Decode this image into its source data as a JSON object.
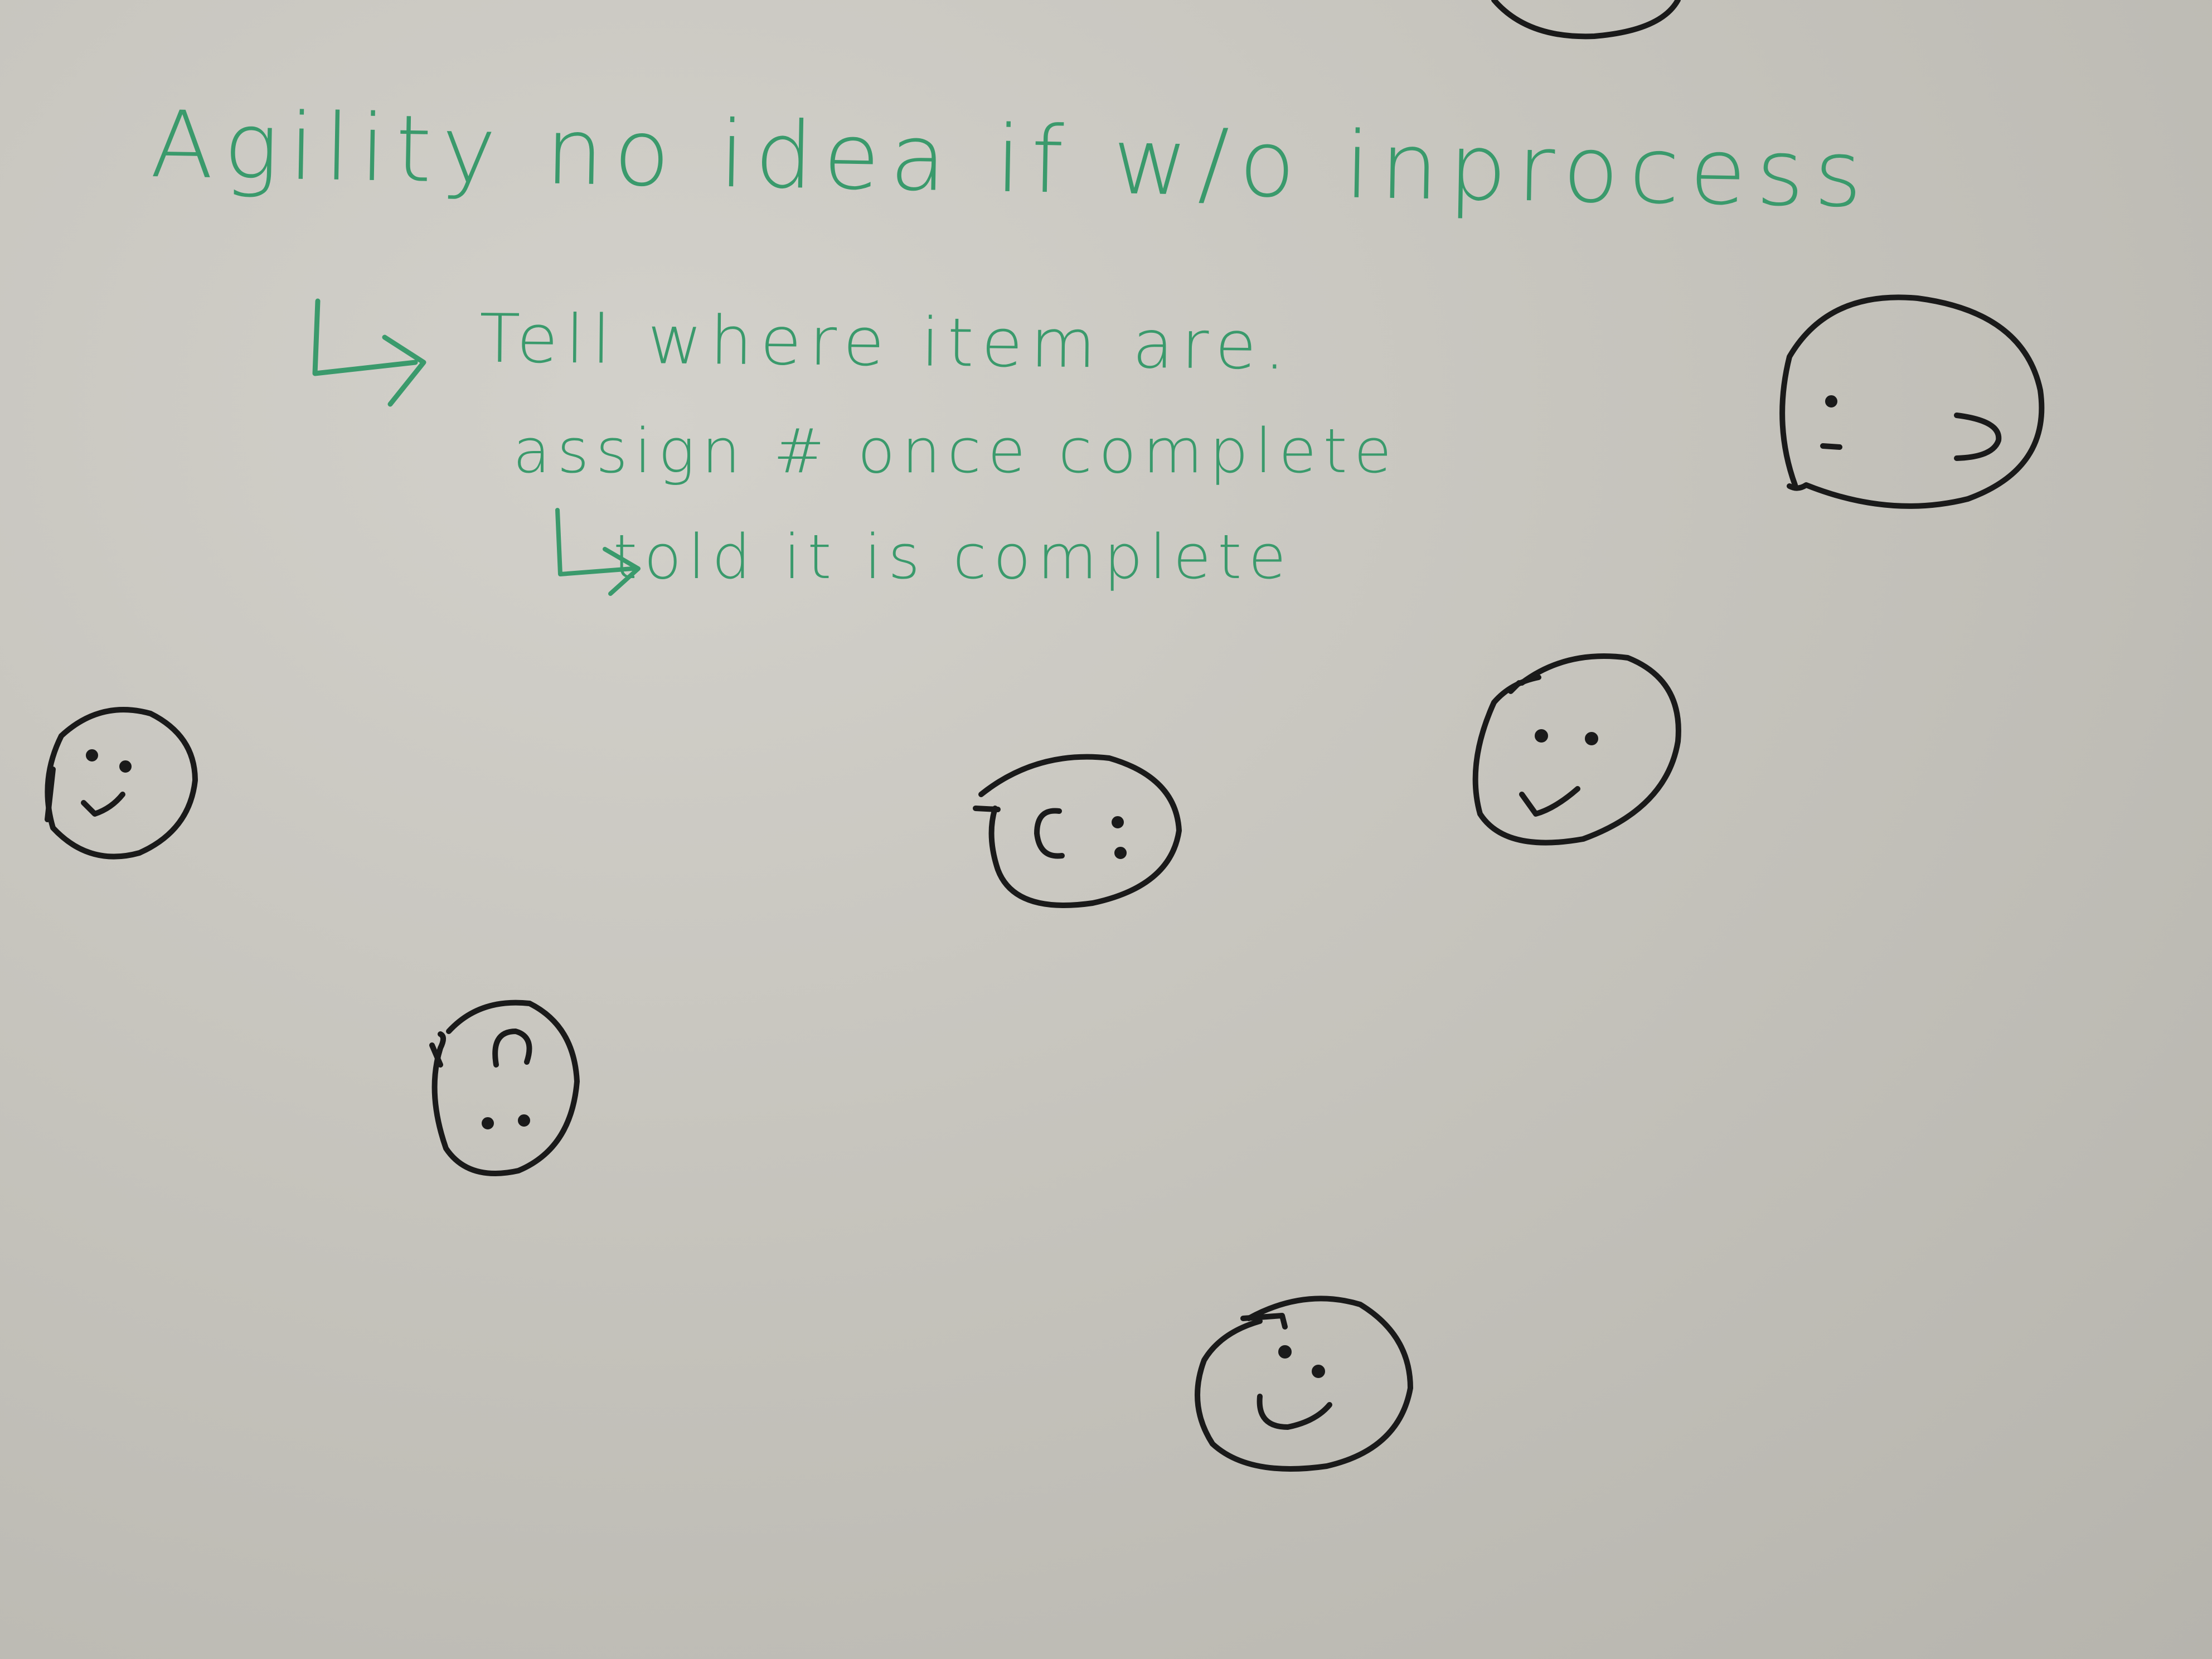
{
  "board": {
    "background_color": "#c8c6c0",
    "marker_green": "#3a9a6c",
    "marker_black": "#1a1a1a"
  },
  "notes": {
    "line1": "Agility no idea if w/o inprocess",
    "line2": "Tell where item are.",
    "line3": "assign # once complete",
    "line4": "told it is complete"
  },
  "icons": [
    "arrow-icon",
    "arrow-icon",
    "smiley-face-icon",
    "happy-face-icon",
    "sad-face-icon",
    "frown-face-icon",
    "neutral-face-icon"
  ]
}
